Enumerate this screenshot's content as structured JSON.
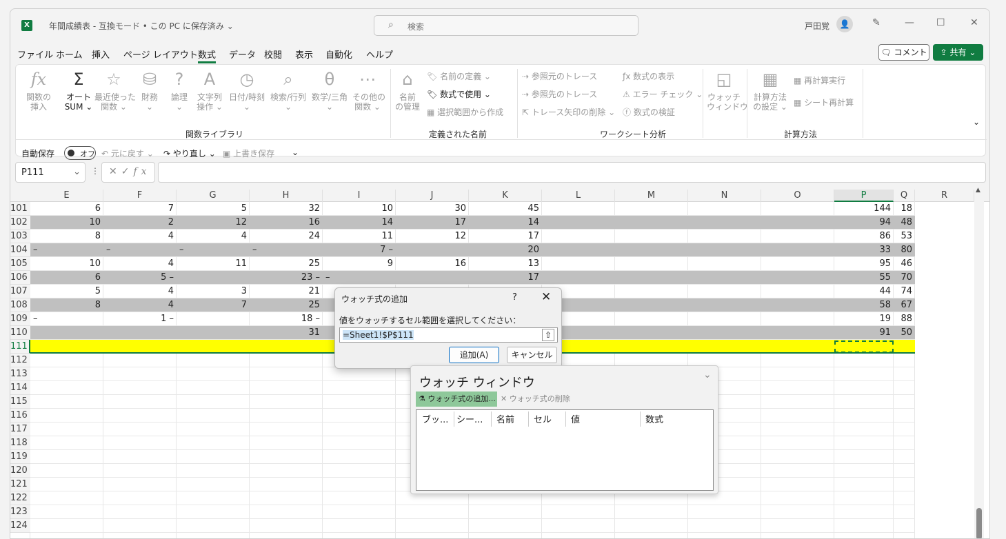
{
  "title": {
    "doc": "年間成績表  -  互換モード • この PC に保存済み ⌄",
    "search": "検索",
    "user": "戸田覚"
  },
  "menu": [
    "ファイル",
    "ホーム",
    "挿入",
    "ページ レイアウト",
    "数式",
    "データ",
    "校閲",
    "表示",
    "自動化",
    "ヘルプ"
  ],
  "buttons": {
    "comment": "コメント",
    "share": "共有 ⌄"
  },
  "ribbon": {
    "lib": {
      "insert_fn": "関数の\n挿入",
      "autosum1": "オート",
      "autosum2": "SUM ⌄",
      "recent": "最近使った\n関数 ⌄",
      "finance": "財務\n⌄",
      "logic": "論理\n⌄",
      "text": "文字列\n操作 ⌄",
      "date": "日付/時刻\n⌄",
      "lookup": "検索/行列\n⌄",
      "math": "数学/三角\n⌄",
      "other": "その他の\n関数 ⌄",
      "label": "関数ライブラリ"
    },
    "names": {
      "mgr": "名前\nの管理",
      "define": "名前の定義  ⌄",
      "use": "数式で使用 ⌄",
      "create": "選択範囲から作成",
      "label": "定義された名前"
    },
    "audit": {
      "prec": "参照元のトレース",
      "dep": "参照先のトレース",
      "remove": "トレース矢印の削除  ⌄",
      "show": "数式の表示",
      "err": "エラー チェック  ⌄",
      "eval": "数式の検証",
      "watch": "ウォッチ\nウィンドウ",
      "label": "ワークシート分析"
    },
    "calc": {
      "opt": "計算方法\nの設定 ⌄",
      "now": "再計算実行",
      "sheet": "シート再計算",
      "label": "計算方法"
    }
  },
  "qat": {
    "autosave": "自動保存",
    "toggle": "オフ",
    "undo": "元に戻す  ⌄",
    "redo": "やり直し  ⌄",
    "save": "上書き保存"
  },
  "namebox": "P111",
  "columns": [
    "E",
    "F",
    "G",
    "H",
    "I",
    "J",
    "K",
    "L",
    "M",
    "N",
    "O",
    "P",
    "Q",
    "R"
  ],
  "rows": [
    {
      "n": "101",
      "v": [
        "6",
        "7",
        "5",
        "32",
        "10",
        "30",
        "45",
        "",
        "",
        "",
        "",
        "144",
        "18"
      ],
      "g": false
    },
    {
      "n": "102",
      "v": [
        "10",
        "2",
        "12",
        "16",
        "14",
        "17",
        "14",
        "",
        "",
        "",
        "",
        "94",
        "48"
      ],
      "g": true
    },
    {
      "n": "103",
      "v": [
        "8",
        "4",
        "4",
        "24",
        "11",
        "12",
        "17",
        "",
        "",
        "",
        "",
        "86",
        "53"
      ],
      "g": false
    },
    {
      "n": "104",
      "v": [
        "–",
        "–",
        "–",
        "–",
        "7 –",
        "",
        "20",
        "",
        "",
        "",
        "",
        "33",
        "80"
      ],
      "g": true,
      "dash": true
    },
    {
      "n": "105",
      "v": [
        "10",
        "4",
        "11",
        "25",
        "9",
        "16",
        "13",
        "",
        "",
        "",
        "",
        "95",
        "46"
      ],
      "g": false
    },
    {
      "n": "106",
      "v": [
        "6",
        "5 –",
        "",
        "23 –",
        "–",
        "",
        "17",
        "",
        "",
        "",
        "",
        "55",
        "70"
      ],
      "g": true
    },
    {
      "n": "107",
      "v": [
        "5",
        "4",
        "3",
        "21",
        "",
        "",
        "",
        "",
        "",
        "",
        "",
        "44",
        "74"
      ],
      "g": false
    },
    {
      "n": "108",
      "v": [
        "8",
        "4",
        "7",
        "25",
        "",
        "",
        "",
        "",
        "",
        "",
        "",
        "58",
        "67"
      ],
      "g": true
    },
    {
      "n": "109",
      "v": [
        "–",
        "1 –",
        "",
        "18 –",
        "",
        "",
        "",
        "",
        "",
        "",
        "",
        "19",
        "88"
      ],
      "g": false
    },
    {
      "n": "110",
      "v": [
        "",
        "",
        "",
        "31",
        "",
        "",
        "",
        "",
        "",
        "",
        "",
        "91",
        "50"
      ],
      "g": true
    },
    {
      "n": "111",
      "v": [],
      "y": true
    },
    {
      "n": "112",
      "v": []
    },
    {
      "n": "113",
      "v": []
    },
    {
      "n": "114",
      "v": []
    },
    {
      "n": "115",
      "v": []
    },
    {
      "n": "116",
      "v": []
    },
    {
      "n": "117",
      "v": []
    },
    {
      "n": "118",
      "v": []
    },
    {
      "n": "119",
      "v": []
    },
    {
      "n": "120",
      "v": []
    },
    {
      "n": "121",
      "v": []
    },
    {
      "n": "122",
      "v": []
    },
    {
      "n": "123",
      "v": []
    },
    {
      "n": "124",
      "v": []
    }
  ],
  "dialog": {
    "title": "ウォッチ式の追加",
    "help": "?",
    "prompt": "値をウォッチするセル範囲を選択してください：",
    "value": "=Sheet1!$P$111",
    "ok": "追加(A)",
    "cancel": "キャンセル"
  },
  "watch": {
    "title": "ウォッチ ウィンドウ",
    "add": "ウォッチ式の追加...",
    "del": "ウォッチ式の削除",
    "headers": [
      "ブッ...",
      "シー...",
      "名前",
      "セル",
      "値",
      "数式"
    ]
  },
  "colors": {
    "accent": "#107c41",
    "gray_row": "#c0c0c0",
    "yellow": "#ffff00"
  }
}
